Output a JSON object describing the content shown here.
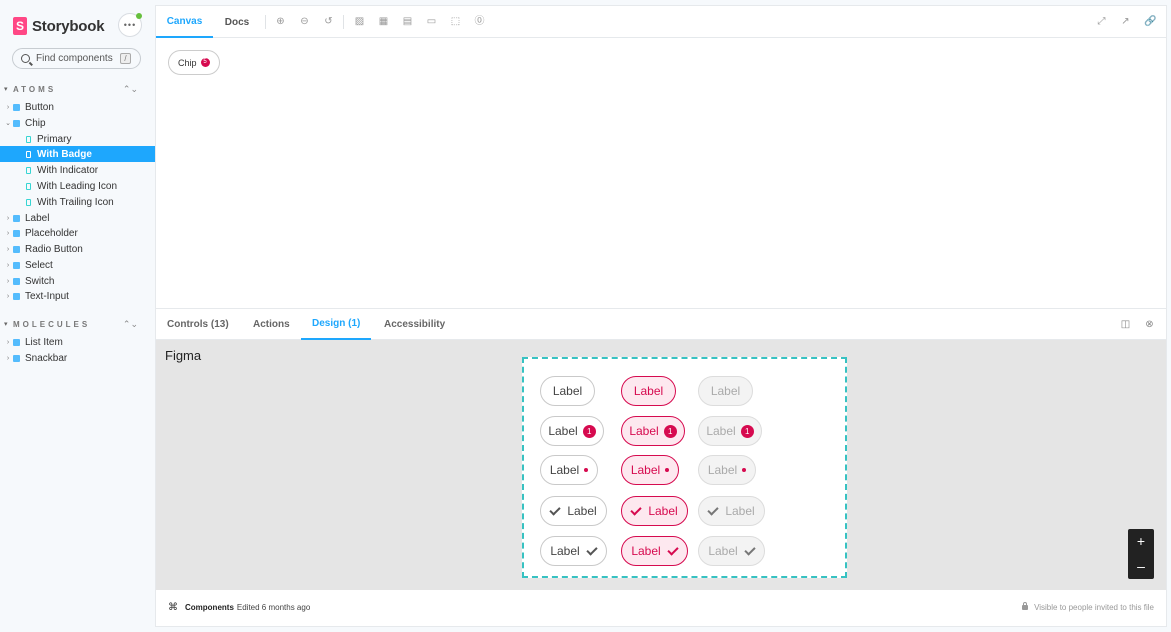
{
  "brand": {
    "name": "Storybook",
    "logo_letter": "S"
  },
  "search": {
    "placeholder": "Find components",
    "shortcut": "/"
  },
  "sidebar": {
    "groups": [
      {
        "title": "ATOMS",
        "items": [
          {
            "label": "Button",
            "type": "component",
            "expanded": false
          },
          {
            "label": "Chip",
            "type": "component",
            "expanded": true
          },
          {
            "label": "Primary",
            "type": "story"
          },
          {
            "label": "With Badge",
            "type": "story",
            "selected": true
          },
          {
            "label": "With Indicator",
            "type": "story"
          },
          {
            "label": "With Leading Icon",
            "type": "story"
          },
          {
            "label": "With Trailing Icon",
            "type": "story"
          },
          {
            "label": "Label",
            "type": "component",
            "expanded": false
          },
          {
            "label": "Placeholder",
            "type": "component",
            "expanded": false
          },
          {
            "label": "Radio Button",
            "type": "component",
            "expanded": false
          },
          {
            "label": "Select",
            "type": "component",
            "expanded": false
          },
          {
            "label": "Switch",
            "type": "component",
            "expanded": false
          },
          {
            "label": "Text-Input",
            "type": "component",
            "expanded": false
          }
        ]
      },
      {
        "title": "MOLECULES",
        "items": [
          {
            "label": "List Item",
            "type": "component",
            "expanded": false
          },
          {
            "label": "Snackbar",
            "type": "component",
            "expanded": false
          }
        ]
      }
    ]
  },
  "toolbar": {
    "tabs": [
      {
        "label": "Canvas",
        "active": true
      },
      {
        "label": "Docs",
        "active": false
      }
    ]
  },
  "canvas": {
    "chip_label": "Chip",
    "chip_badge": "5"
  },
  "addons": {
    "tabs": [
      {
        "label": "Controls (13)",
        "active": false
      },
      {
        "label": "Actions",
        "active": false
      },
      {
        "label": "Design (1)",
        "active": true
      },
      {
        "label": "Accessibility",
        "active": false
      }
    ]
  },
  "figma": {
    "title": "Figma",
    "chip_label": "Label",
    "badge_value": "1",
    "zoom_in": "+",
    "zoom_out": "–"
  },
  "footer": {
    "file_name": "Components",
    "edited": "Edited 6 months ago",
    "visibility": "Visible to people invited to this file"
  },
  "colors": {
    "accent": "#1ea7fd",
    "chip_active": "#d60a4f",
    "frame_border": "#37c2c2"
  }
}
